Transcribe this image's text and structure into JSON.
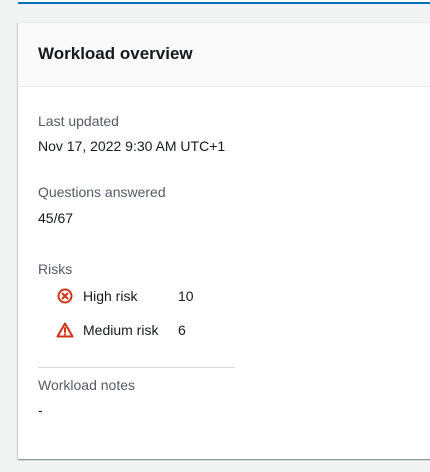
{
  "card": {
    "title": "Workload overview"
  },
  "last_updated": {
    "label": "Last updated",
    "value": "Nov 17, 2022 9:30 AM UTC+1"
  },
  "questions_answered": {
    "label": "Questions answered",
    "value": "45/67"
  },
  "risks": {
    "label": "Risks",
    "items": [
      {
        "name": "High risk",
        "count": "10",
        "icon": "error-circle-icon",
        "color": "#d13212"
      },
      {
        "name": "Medium risk",
        "count": "6",
        "icon": "warning-triangle-icon",
        "color": "#d13212"
      }
    ]
  },
  "workload_notes": {
    "label": "Workload notes",
    "value": "-"
  },
  "colors": {
    "accent": "#0073bb",
    "risk_red": "#d13212"
  }
}
